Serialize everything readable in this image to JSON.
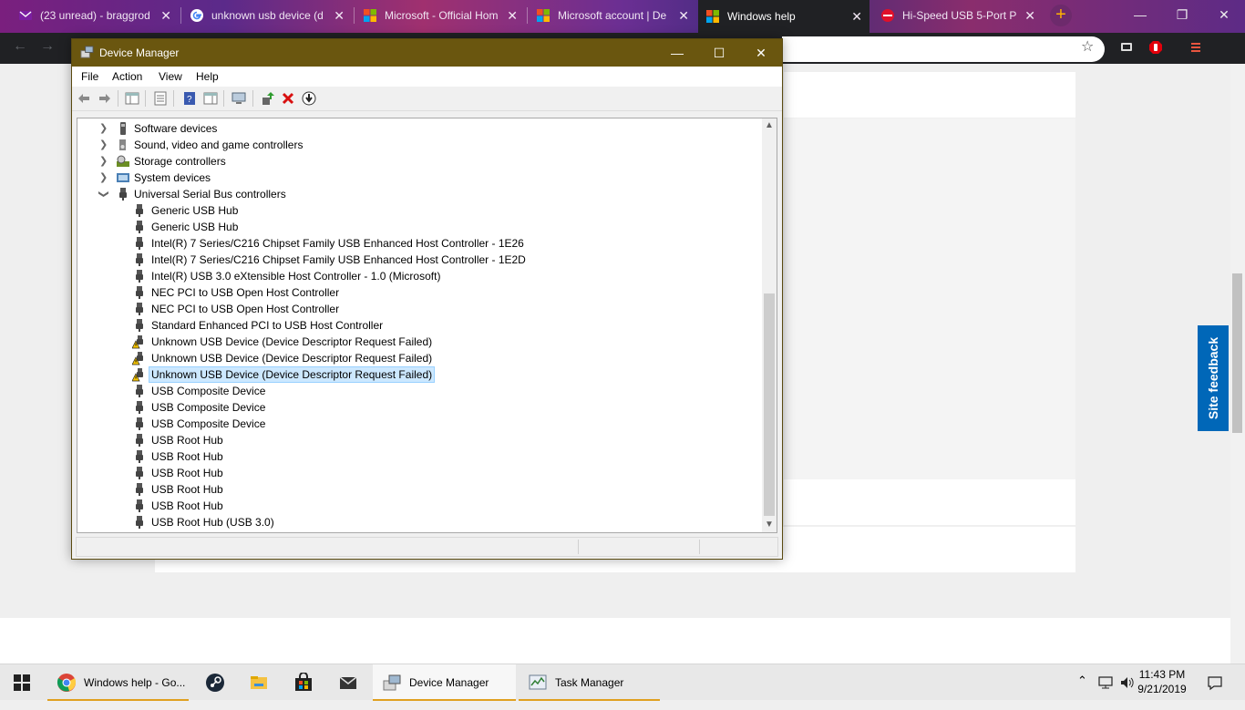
{
  "browser": {
    "tabs": [
      {
        "label": "(23 unread) - braggrod"
      },
      {
        "label": "unknown usb device (d"
      },
      {
        "label": "Microsoft - Official Hom"
      },
      {
        "label": "Microsoft account | De"
      },
      {
        "label": "Windows help"
      },
      {
        "label": "Hi-Speed USB 5-Port P"
      }
    ],
    "new_tab_symbol": "+",
    "colors": {
      "tab_strip": "#6b2f93",
      "toolbar": "#202124"
    }
  },
  "page": {
    "feedback_label": "Site feedback",
    "accent": "#0067b8"
  },
  "device_manager": {
    "title": "Device Manager",
    "menu": [
      "File",
      "Action",
      "View",
      "Help"
    ],
    "tree": [
      {
        "label": "Software devices",
        "level": 1,
        "icon": "software-device-icon",
        "expander": "collapsed"
      },
      {
        "label": "Sound, video and game controllers",
        "level": 1,
        "icon": "speaker-icon",
        "expander": "collapsed"
      },
      {
        "label": "Storage controllers",
        "level": 1,
        "icon": "storage-controller-icon",
        "expander": "collapsed"
      },
      {
        "label": "System devices",
        "level": 1,
        "icon": "system-devices-icon",
        "expander": "collapsed"
      },
      {
        "label": "Universal Serial Bus controllers",
        "level": 1,
        "icon": "usb-plug-icon",
        "expander": "expanded"
      },
      {
        "label": "Generic USB Hub",
        "level": 2,
        "icon": "usb-plug-icon"
      },
      {
        "label": "Generic USB Hub",
        "level": 2,
        "icon": "usb-plug-icon"
      },
      {
        "label": "Intel(R) 7 Series/C216 Chipset Family USB Enhanced Host Controller - 1E26",
        "level": 2,
        "icon": "usb-plug-icon"
      },
      {
        "label": "Intel(R) 7 Series/C216 Chipset Family USB Enhanced Host Controller - 1E2D",
        "level": 2,
        "icon": "usb-plug-icon"
      },
      {
        "label": "Intel(R) USB 3.0 eXtensible Host Controller - 1.0 (Microsoft)",
        "level": 2,
        "icon": "usb-plug-icon"
      },
      {
        "label": "NEC PCI to USB Open Host Controller",
        "level": 2,
        "icon": "usb-plug-icon"
      },
      {
        "label": "NEC PCI to USB Open Host Controller",
        "level": 2,
        "icon": "usb-plug-icon"
      },
      {
        "label": "Standard Enhanced PCI to USB Host Controller",
        "level": 2,
        "icon": "usb-plug-icon"
      },
      {
        "label": "Unknown USB Device (Device Descriptor Request Failed)",
        "level": 2,
        "icon": "warning-usb-icon"
      },
      {
        "label": "Unknown USB Device (Device Descriptor Request Failed)",
        "level": 2,
        "icon": "warning-usb-icon"
      },
      {
        "label": "Unknown USB Device (Device Descriptor Request Failed)",
        "level": 2,
        "icon": "warning-usb-icon",
        "selected": true
      },
      {
        "label": "USB Composite Device",
        "level": 2,
        "icon": "usb-plug-icon"
      },
      {
        "label": "USB Composite Device",
        "level": 2,
        "icon": "usb-plug-icon"
      },
      {
        "label": "USB Composite Device",
        "level": 2,
        "icon": "usb-plug-icon"
      },
      {
        "label": "USB Root Hub",
        "level": 2,
        "icon": "usb-plug-icon"
      },
      {
        "label": "USB Root Hub",
        "level": 2,
        "icon": "usb-plug-icon"
      },
      {
        "label": "USB Root Hub",
        "level": 2,
        "icon": "usb-plug-icon"
      },
      {
        "label": "USB Root Hub",
        "level": 2,
        "icon": "usb-plug-icon"
      },
      {
        "label": "USB Root Hub",
        "level": 2,
        "icon": "usb-plug-icon"
      },
      {
        "label": "USB Root Hub (USB 3.0)",
        "level": 2,
        "icon": "usb-plug-icon"
      }
    ],
    "colors": {
      "titlebar": "#6a560f",
      "selection": "#cce8ff"
    }
  },
  "taskbar": {
    "items": [
      {
        "label": "Windows help - Go...",
        "icon": "chrome-icon"
      },
      {
        "label": "",
        "icon": "steam-icon"
      },
      {
        "label": "",
        "icon": "file-explorer-icon"
      },
      {
        "label": "",
        "icon": "store-icon"
      },
      {
        "label": "",
        "icon": "mail-icon"
      },
      {
        "label": "Device Manager",
        "icon": "device-manager-icon"
      },
      {
        "label": "Task Manager",
        "icon": "task-manager-icon"
      }
    ],
    "clock": {
      "time": "11:43 PM",
      "date": "9/21/2019"
    }
  }
}
